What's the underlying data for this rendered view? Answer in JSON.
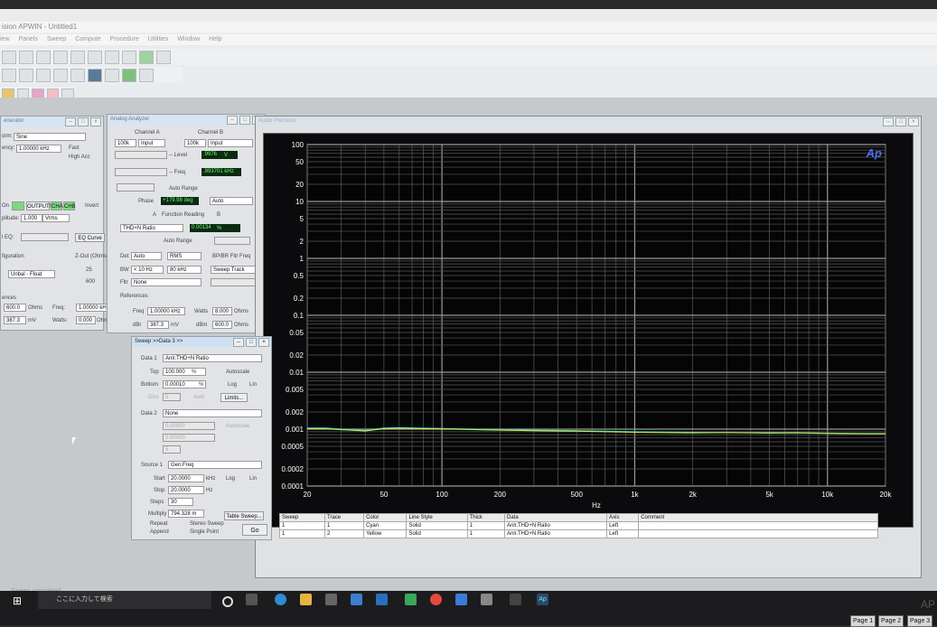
{
  "app": {
    "title": "ision APWIN - Untitled1"
  },
  "menu": [
    "iew",
    "Panels",
    "Sweep",
    "Compute",
    "Procedure",
    "Utilities",
    "Window",
    "Help"
  ],
  "generator": {
    "title": "enerator",
    "waveform_label": "orm:",
    "waveform_value": "Sine",
    "freq_label": "ency:",
    "freq_value": "1.00000 kHz",
    "fast_label": "Fast",
    "highacc_label": "High Acc",
    "on_label": "On",
    "outputs_label": "OUTPUTS",
    "cha": "CHA",
    "chb": "CHB",
    "invert_label": "Invert",
    "ampl_label": "plitude:",
    "ampl_value": "1.000",
    "ampl_unit": "Vrms",
    "eq_label": "l EQ:",
    "eq_curve_btn": "EQ Curve",
    "config_label": "figuration",
    "config_value": "Unbal - Float",
    "zout_label": "Z-Out (Ohms)",
    "zout_25": "25",
    "zout_600": "600",
    "refs_label": "ences",
    "ref_ohms": "600.0",
    "ref_ohms_unit": "Ohms",
    "ref_freq_label": "Freq:",
    "ref_freq_value": "1.00000 kHz",
    "ref_mv": "387.3",
    "ref_mv_unit": "mV",
    "watts_label": "Watts:",
    "watts_value": "0.000",
    "watts_unit": "Ohms"
  },
  "analyzer": {
    "title": "Analog Analyzer",
    "cha": "Channel A",
    "chb": "Channel B",
    "cha_range": "100k",
    "cha_input": "Input",
    "chb_range": "100k",
    "chb_input": "Input",
    "level_label": "-- Level",
    "level_value": ".9976",
    "level_unit": "V",
    "freq_label": "-- Freq",
    "freq_value": ".993701 kHz",
    "autorange_label": "Auto Range",
    "phase_label": "Phase",
    "phase_value": "+179.98 deg",
    "phase_auto": "Auto",
    "a_label": "A",
    "function_reading": "Function Reading",
    "b_label": "B",
    "func_sel": "THD+N Ratio",
    "func_value": "0.00134",
    "func_unit": "%",
    "autorange2": "Auto Range",
    "det_label": "Det",
    "det_value": "Auto",
    "rms": "RMS",
    "bpbr_label": "BP/BR Fltr Freq",
    "bw_label": "BW",
    "bw_low": "< 10 Hz",
    "bw_high": "80 kHz",
    "sweep_track": "Sweep Track",
    "fltr_label": "Fltr",
    "fltr_value": "None",
    "refs_label": "References",
    "freq_ref_label": "Freq",
    "freq_ref_value": "1.00000 kHz",
    "watts_label": "Watts",
    "watts_value": "8.000",
    "watts_unit": "Ohms",
    "dbr_label": "dBr",
    "dbr_value": "387.3",
    "dbr_unit": "mV",
    "dbm_label": "dBm",
    "dbm_value": "600.0",
    "dbm_unit": "Ohms"
  },
  "sweep": {
    "title": "Sweep >>Data 3 >>",
    "data1_label": "Data 1",
    "data1_value": "Anlr.THD+N Ratio",
    "top_label": "Top",
    "top_value": "100.000",
    "top_unit": "%",
    "autoscale": "Autoscale",
    "bottom_label": "Bottom",
    "bottom_value": "0.00010",
    "bottom_unit": "%",
    "log_label": "Log",
    "lin_label": "Lin",
    "divs_label": "Divs",
    "divs_value": "5",
    "auto_label": "Auto",
    "limits_btn": "Limits...",
    "data2_label": "Data 2",
    "data2_value": "None",
    "top2_value": "0.00000",
    "bottom2_value": "0.00000",
    "autoscale2": "Autoscale",
    "divs2_value": "5",
    "source1_label": "Source 1",
    "source1_value": "Gen.Freq",
    "start_label": "Start",
    "start_value": "20.0000",
    "start_unit": "kHz",
    "stop_label": "Stop",
    "stop_value": "20.0000",
    "stop_unit": "Hz",
    "steps_label": "Steps",
    "steps_value": "30",
    "multiply_label": "Multiply",
    "multiply_value": "794.328 m",
    "table_sweep": "Table Sweep...",
    "repeat_label": "Repeat",
    "stereo_label": "Stereo Sweep",
    "append_label": "Append",
    "single_point": "Single Point",
    "go_btn": "Go"
  },
  "graph": {
    "title": "Audio Precision",
    "logo": "Ap",
    "x_unit_label": "Hz",
    "y_unit_label": "%",
    "legend_headers": [
      "Sweep",
      "Trace",
      "Color",
      "Line Style",
      "Thick",
      "Data",
      "Axis",
      "Comment"
    ],
    "legend_rows": [
      [
        "1",
        "1",
        "Cyan",
        "Solid",
        "1",
        "Anlr.THD+N Ratio",
        "Left",
        ""
      ],
      [
        "1",
        "2",
        "Yellow",
        "Solid",
        "1",
        "Anlr.THD+N Ratio",
        "Left",
        ""
      ]
    ]
  },
  "chart_data": {
    "type": "line",
    "xscale": "log",
    "yscale": "log",
    "xlim": [
      20,
      20000
    ],
    "ylim": [
      0.0001,
      100
    ],
    "xticks": [
      20,
      50,
      100,
      200,
      500,
      1000,
      2000,
      5000,
      10000,
      20000
    ],
    "xtick_labels": [
      "20",
      "50",
      "100",
      "200",
      "500",
      "1k",
      "2k",
      "5k",
      "10k",
      "20k"
    ],
    "yticks": [
      100,
      50,
      20,
      10,
      5,
      2,
      1,
      0.5,
      0.2,
      0.1,
      0.05,
      0.02,
      0.01,
      0.005,
      0.002,
      0.001,
      0.0005,
      0.0002,
      0.0001
    ],
    "ytick_labels": [
      "100",
      "50",
      "20",
      "10",
      "5",
      "2",
      "1",
      "0.5",
      "0.2",
      "0.1",
      "0.05",
      "0.02",
      "0.01",
      "0.005",
      "0.002",
      "0.001",
      "0.0005",
      "0.0002",
      "0.0001"
    ],
    "xlabel": "Hz",
    "ylabel": "%",
    "grid": true,
    "series": [
      {
        "color": "#00e5e5",
        "x": [
          20,
          25,
          30,
          40,
          50,
          60,
          80,
          100,
          150,
          200,
          300,
          500,
          700,
          1000,
          2000,
          3000,
          5000,
          7000,
          10000,
          15000,
          20000
        ],
        "y": [
          0.00105,
          0.00105,
          0.001,
          0.00095,
          0.00105,
          0.00106,
          0.00104,
          0.00103,
          0.001,
          0.00098,
          0.00096,
          0.00094,
          0.00092,
          0.0009,
          0.00088,
          0.00087,
          0.00087,
          0.00087,
          0.00085,
          0.00084,
          0.00084
        ]
      },
      {
        "color": "#e6e633",
        "x": [
          20,
          25,
          30,
          40,
          50,
          60,
          80,
          100,
          150,
          200,
          300,
          500,
          700,
          1000,
          2000,
          3000,
          5000,
          7000,
          10000,
          15000,
          20000
        ],
        "y": [
          0.00102,
          0.00102,
          0.00098,
          0.00093,
          0.00102,
          0.00104,
          0.00102,
          0.00101,
          0.00098,
          0.00096,
          0.00094,
          0.00092,
          0.0009,
          0.00088,
          0.00086,
          0.00087,
          0.00085,
          0.00086,
          0.00084,
          0.00083,
          0.00083
        ]
      }
    ]
  },
  "status": {
    "text": "Sweep completed"
  },
  "taskbar": {
    "search_placeholder": "ここに入力して検索"
  },
  "pages": [
    "Page 1",
    "Page 2",
    "Page 3"
  ],
  "watermark": "AP"
}
